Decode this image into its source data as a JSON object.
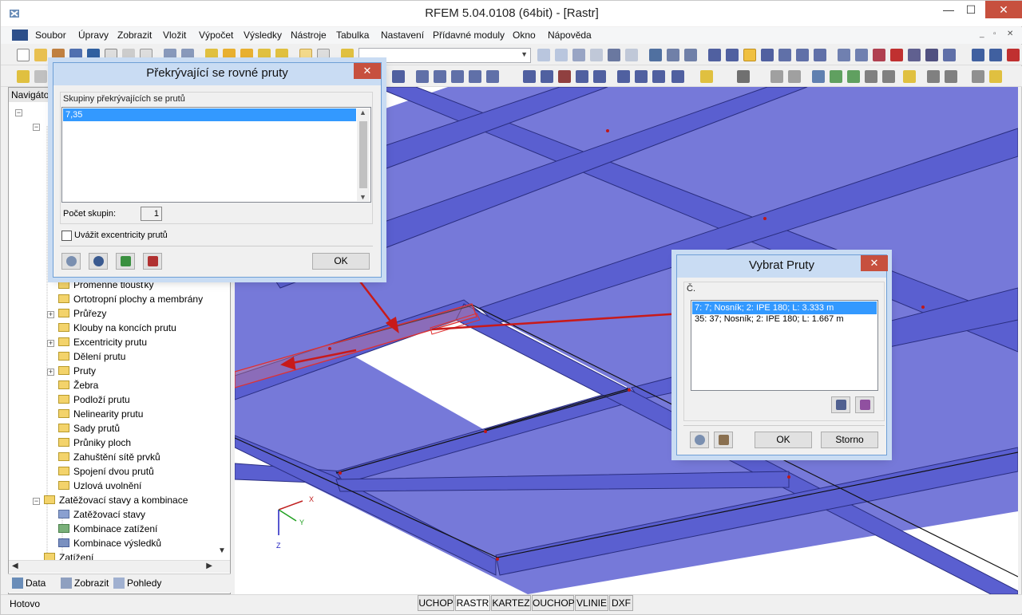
{
  "window": {
    "title": "RFEM 5.04.0108 (64bit) - [Rastr]",
    "min": "—",
    "max": "☐",
    "close": "✕"
  },
  "menu": [
    "Soubor",
    "Úpravy",
    "Zobrazit",
    "Vložit",
    "Výpočet",
    "Výsledky",
    "Nástroje",
    "Tabulka",
    "Nastavení",
    "Přídavné moduly",
    "Okno",
    "Nápověda"
  ],
  "mdi_controls": [
    "_",
    "▫",
    "✕"
  ],
  "navigator": {
    "header": "Navigáto",
    "items": [
      "Proměnné tloušťky",
      "Ortotropní plochy a membrány",
      "Průřezy",
      "Klouby na koncích prutu",
      "Excentricity prutu",
      "Dělení prutu",
      "Pruty",
      "Žebra",
      "Podloží prutu",
      "Nelinearity prutu",
      "Sady prutů",
      "Průniky ploch",
      "Zahuštění sítě prvků",
      "Spojení dvou prutů",
      "Uzlová uvolnění",
      "Zatěžovací stavy a kombinace",
      "Zatěžovací stavy",
      "Kombinace zatížení",
      "Kombinace výsledků",
      "Zatížení"
    ],
    "tabs": [
      "Data",
      "Zobrazit",
      "Pohledy"
    ]
  },
  "status": {
    "text": "Hotovo",
    "buttons": [
      "UCHOP",
      "RASTR",
      "KARTEZ",
      "OUCHOP",
      "VLINIE",
      "DXF"
    ]
  },
  "axes": {
    "x": "X",
    "y": "Y",
    "z": "Z"
  },
  "dialog1": {
    "title": "Překrývající se rovné pruty",
    "group_label": "Skupiny překrývajících se prutů",
    "list": [
      "7,35"
    ],
    "count_label": "Počet skupin:",
    "count_value": "1",
    "checkbox_label": "Uvážit excentricity prutů",
    "ok": "OK"
  },
  "dialog2": {
    "title": "Vybrat Pruty",
    "column_label": "Č.",
    "list": [
      "7: 7; Nosník; 2: IPE 180; L: 3.333 m",
      "35: 37; Nosník; 2: IPE 180; L: 1.667 m"
    ],
    "ok": "OK",
    "cancel": "Storno"
  },
  "colors": {
    "accent": "#3399ff",
    "slab": "#6a6ed6",
    "beam": "#5a5fd0",
    "highlight": "#e03030"
  }
}
